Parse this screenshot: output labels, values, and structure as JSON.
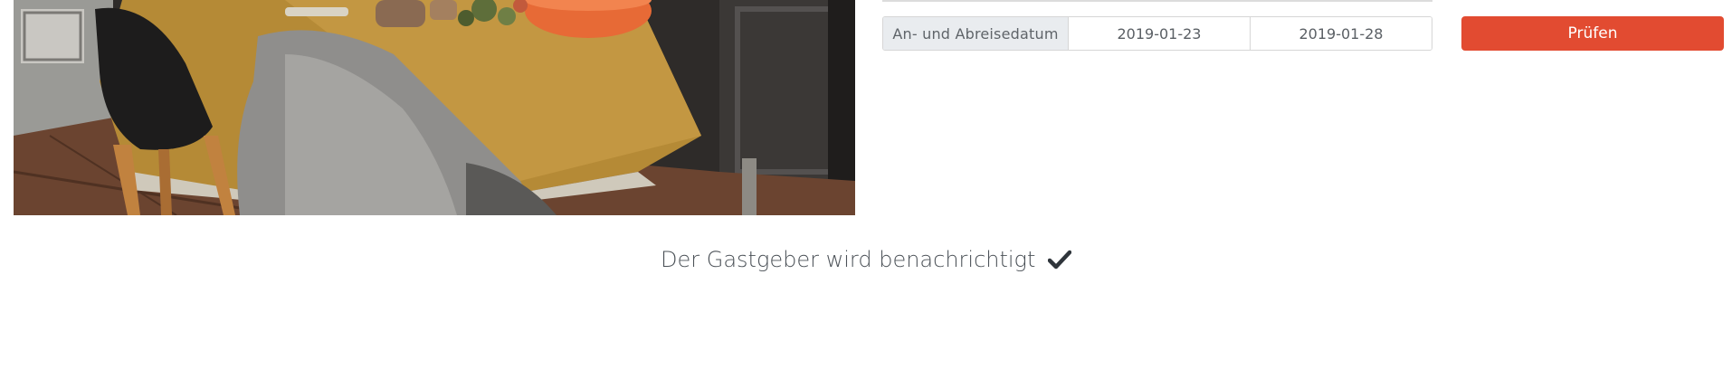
{
  "booking": {
    "date_label": "An- und Abreisedatum",
    "arrival_date": "2019-01-23",
    "departure_date": "2019-01-28",
    "check_button_label": "Prüfen"
  },
  "notice": {
    "text": "Der Gastgeber wird benachrichtigt",
    "icon": "check-icon"
  },
  "colors": {
    "accent": "#e24b31",
    "addon_bg": "#e9ecef",
    "text": "#4b5157"
  }
}
